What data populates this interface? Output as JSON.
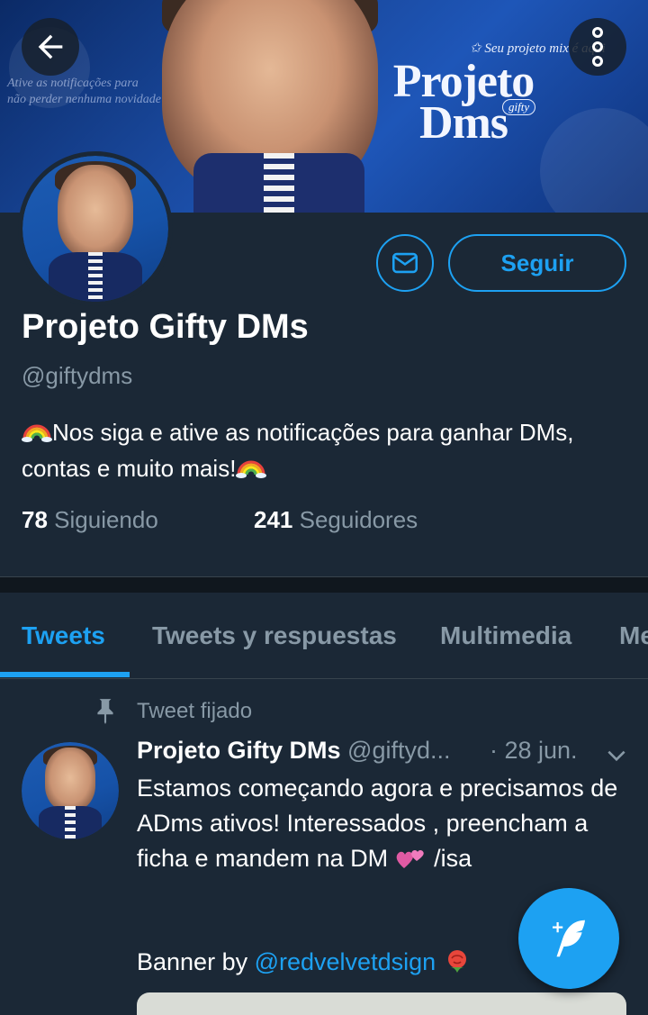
{
  "banner": {
    "notice_line1": "Ative as notificações para",
    "notice_line2": "não perder nenhuma novidade",
    "mix_note": "✩ Seu projeto mix é aqui",
    "logo_line1": "Projeto",
    "logo_line2": "Dms",
    "logo_sub": "gifty"
  },
  "profile": {
    "display_name": "Projeto Gifty DMs",
    "handle": "@giftydms",
    "bio_part1": "Nos siga e ative as notificações para ganhar DMs, contas e muito mais!",
    "follow_label": "Seguir",
    "following_count": "78",
    "following_label": "Siguiendo",
    "followers_count": "241",
    "followers_label": "Seguidores"
  },
  "tabs": [
    {
      "label": "Tweets",
      "active": true
    },
    {
      "label": "Tweets y respuestas",
      "active": false
    },
    {
      "label": "Multimedia",
      "active": false
    },
    {
      "label": "Me",
      "active": false
    }
  ],
  "tweet": {
    "pinned_label": "Tweet fijado",
    "author_name": "Projeto Gifty DMs",
    "author_handle": "@giftyd...",
    "date": "· 28 jun.",
    "text": "Estamos começando agora e precisamos de ADms ativos! Interessados , preencham a ficha e mandem na DM",
    "text_suffix": "/isa",
    "banner_prefix": "Banner by",
    "banner_link": "@redvelvetdsign"
  },
  "icons": {
    "back": "arrow-left-icon",
    "more": "more-vertical-icon",
    "dm": "envelope-icon",
    "pin": "pin-icon",
    "caret": "chevron-down-icon",
    "compose": "compose-feather-icon"
  },
  "colors": {
    "background": "#1b2836",
    "accent": "#1da1f2",
    "secondary_text": "#8899a6"
  }
}
